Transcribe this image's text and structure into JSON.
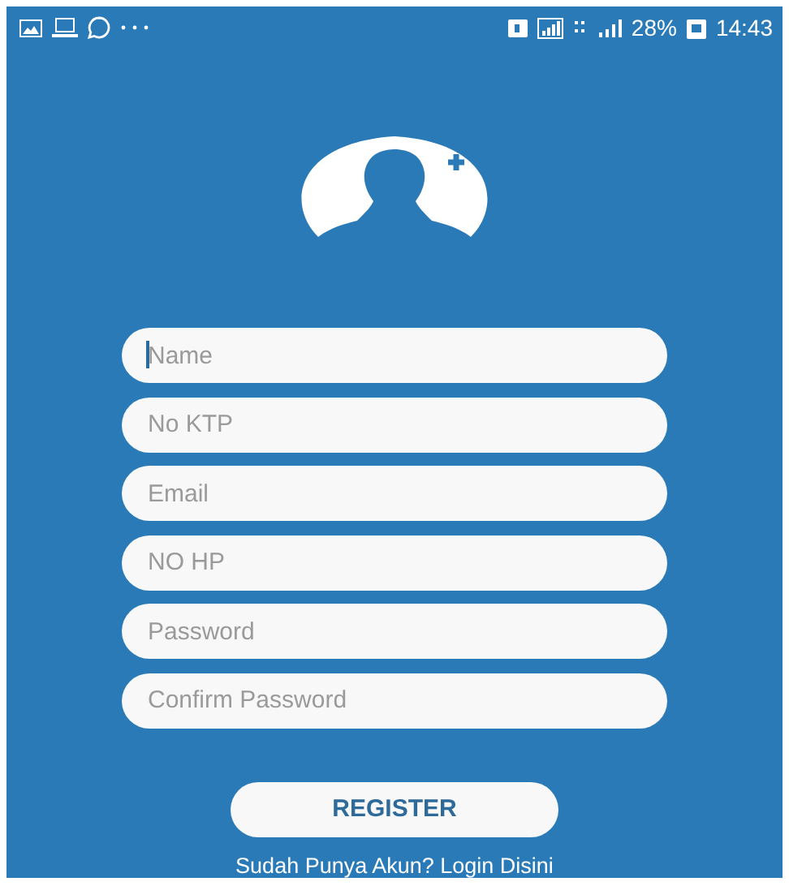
{
  "status_bar": {
    "battery": "28%",
    "time": "14:43"
  },
  "fields": [
    {
      "placeholder": "Name",
      "focused": true
    },
    {
      "placeholder": "No KTP",
      "focused": false
    },
    {
      "placeholder": "Email",
      "focused": false
    },
    {
      "placeholder": "NO HP",
      "focused": false
    },
    {
      "placeholder": "Password",
      "focused": false
    },
    {
      "placeholder": "Confirm Password",
      "focused": false
    }
  ],
  "register_button": "REGISTER",
  "login_link": "Sudah Punya Akun? Login Disini"
}
